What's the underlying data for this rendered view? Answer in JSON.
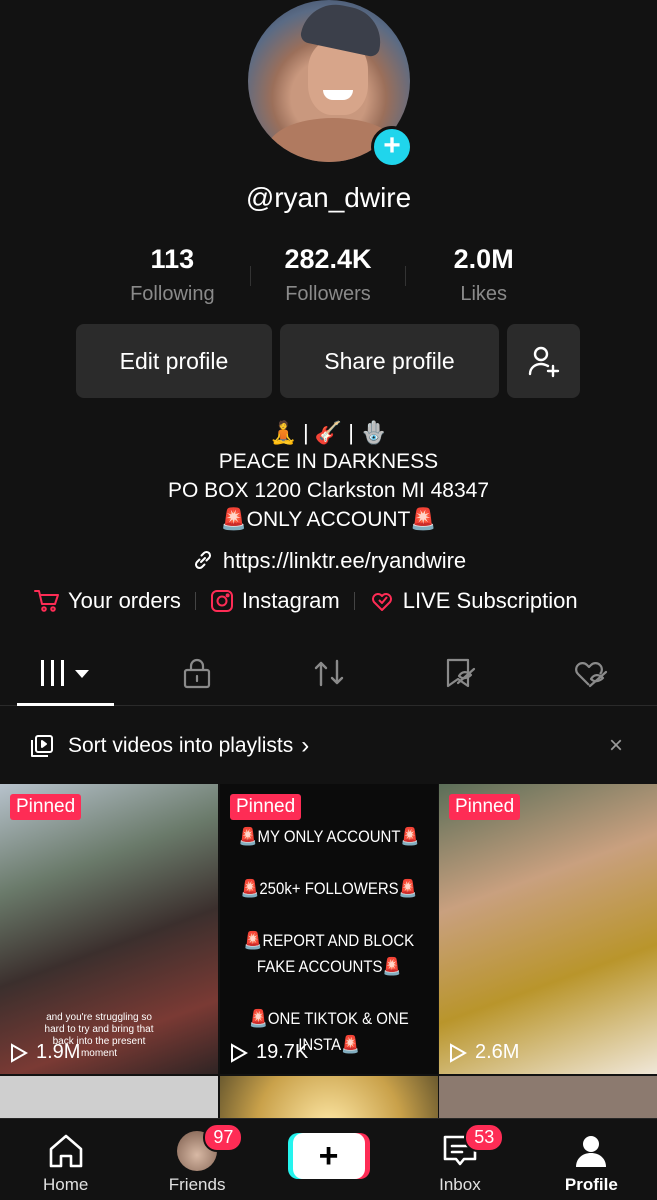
{
  "profile": {
    "username": "@ryan_dwire",
    "stats": [
      {
        "value": "113",
        "label": "Following"
      },
      {
        "value": "282.4K",
        "label": "Followers"
      },
      {
        "value": "2.0M",
        "label": "Likes"
      }
    ],
    "edit_label": "Edit profile",
    "share_label": "Share profile",
    "bio": {
      "emoji_line": "🧘 | 🎸 | 🪬",
      "line1": "PEACE IN DARKNESS",
      "line2": "PO BOX 1200 Clarkston MI 48347",
      "line3": "🚨ONLY ACCOUNT🚨"
    },
    "link": "https://linktr.ee/ryandwire",
    "extras": [
      "Your orders",
      "Instagram",
      "LIVE Subscription"
    ]
  },
  "playlist_bar": {
    "text": "Sort videos into playlists",
    "arrow": "›",
    "close": "×"
  },
  "videos": [
    {
      "pinned": "Pinned",
      "views": "1.9M",
      "caption": "and you're struggling so hard to try and bring that back into the present moment"
    },
    {
      "pinned": "Pinned",
      "views": "19.7K",
      "lines": [
        "🚨MY ONLY ACCOUNT🚨",
        "🚨250k+ FOLLOWERS🚨",
        "🚨REPORT AND BLOCK FAKE ACCOUNTS🚨",
        "🚨ONE TIKTOK & ONE INSTA🚨"
      ]
    },
    {
      "pinned": "Pinned",
      "views": "2.6M"
    }
  ],
  "nav": {
    "home": "Home",
    "friends": "Friends",
    "friends_badge": "97",
    "create": "+",
    "inbox": "Inbox",
    "inbox_badge": "53",
    "profile": "Profile"
  },
  "colors": {
    "accent": "#fe2c55",
    "cyan": "#20d5ec",
    "background": "#121212"
  }
}
